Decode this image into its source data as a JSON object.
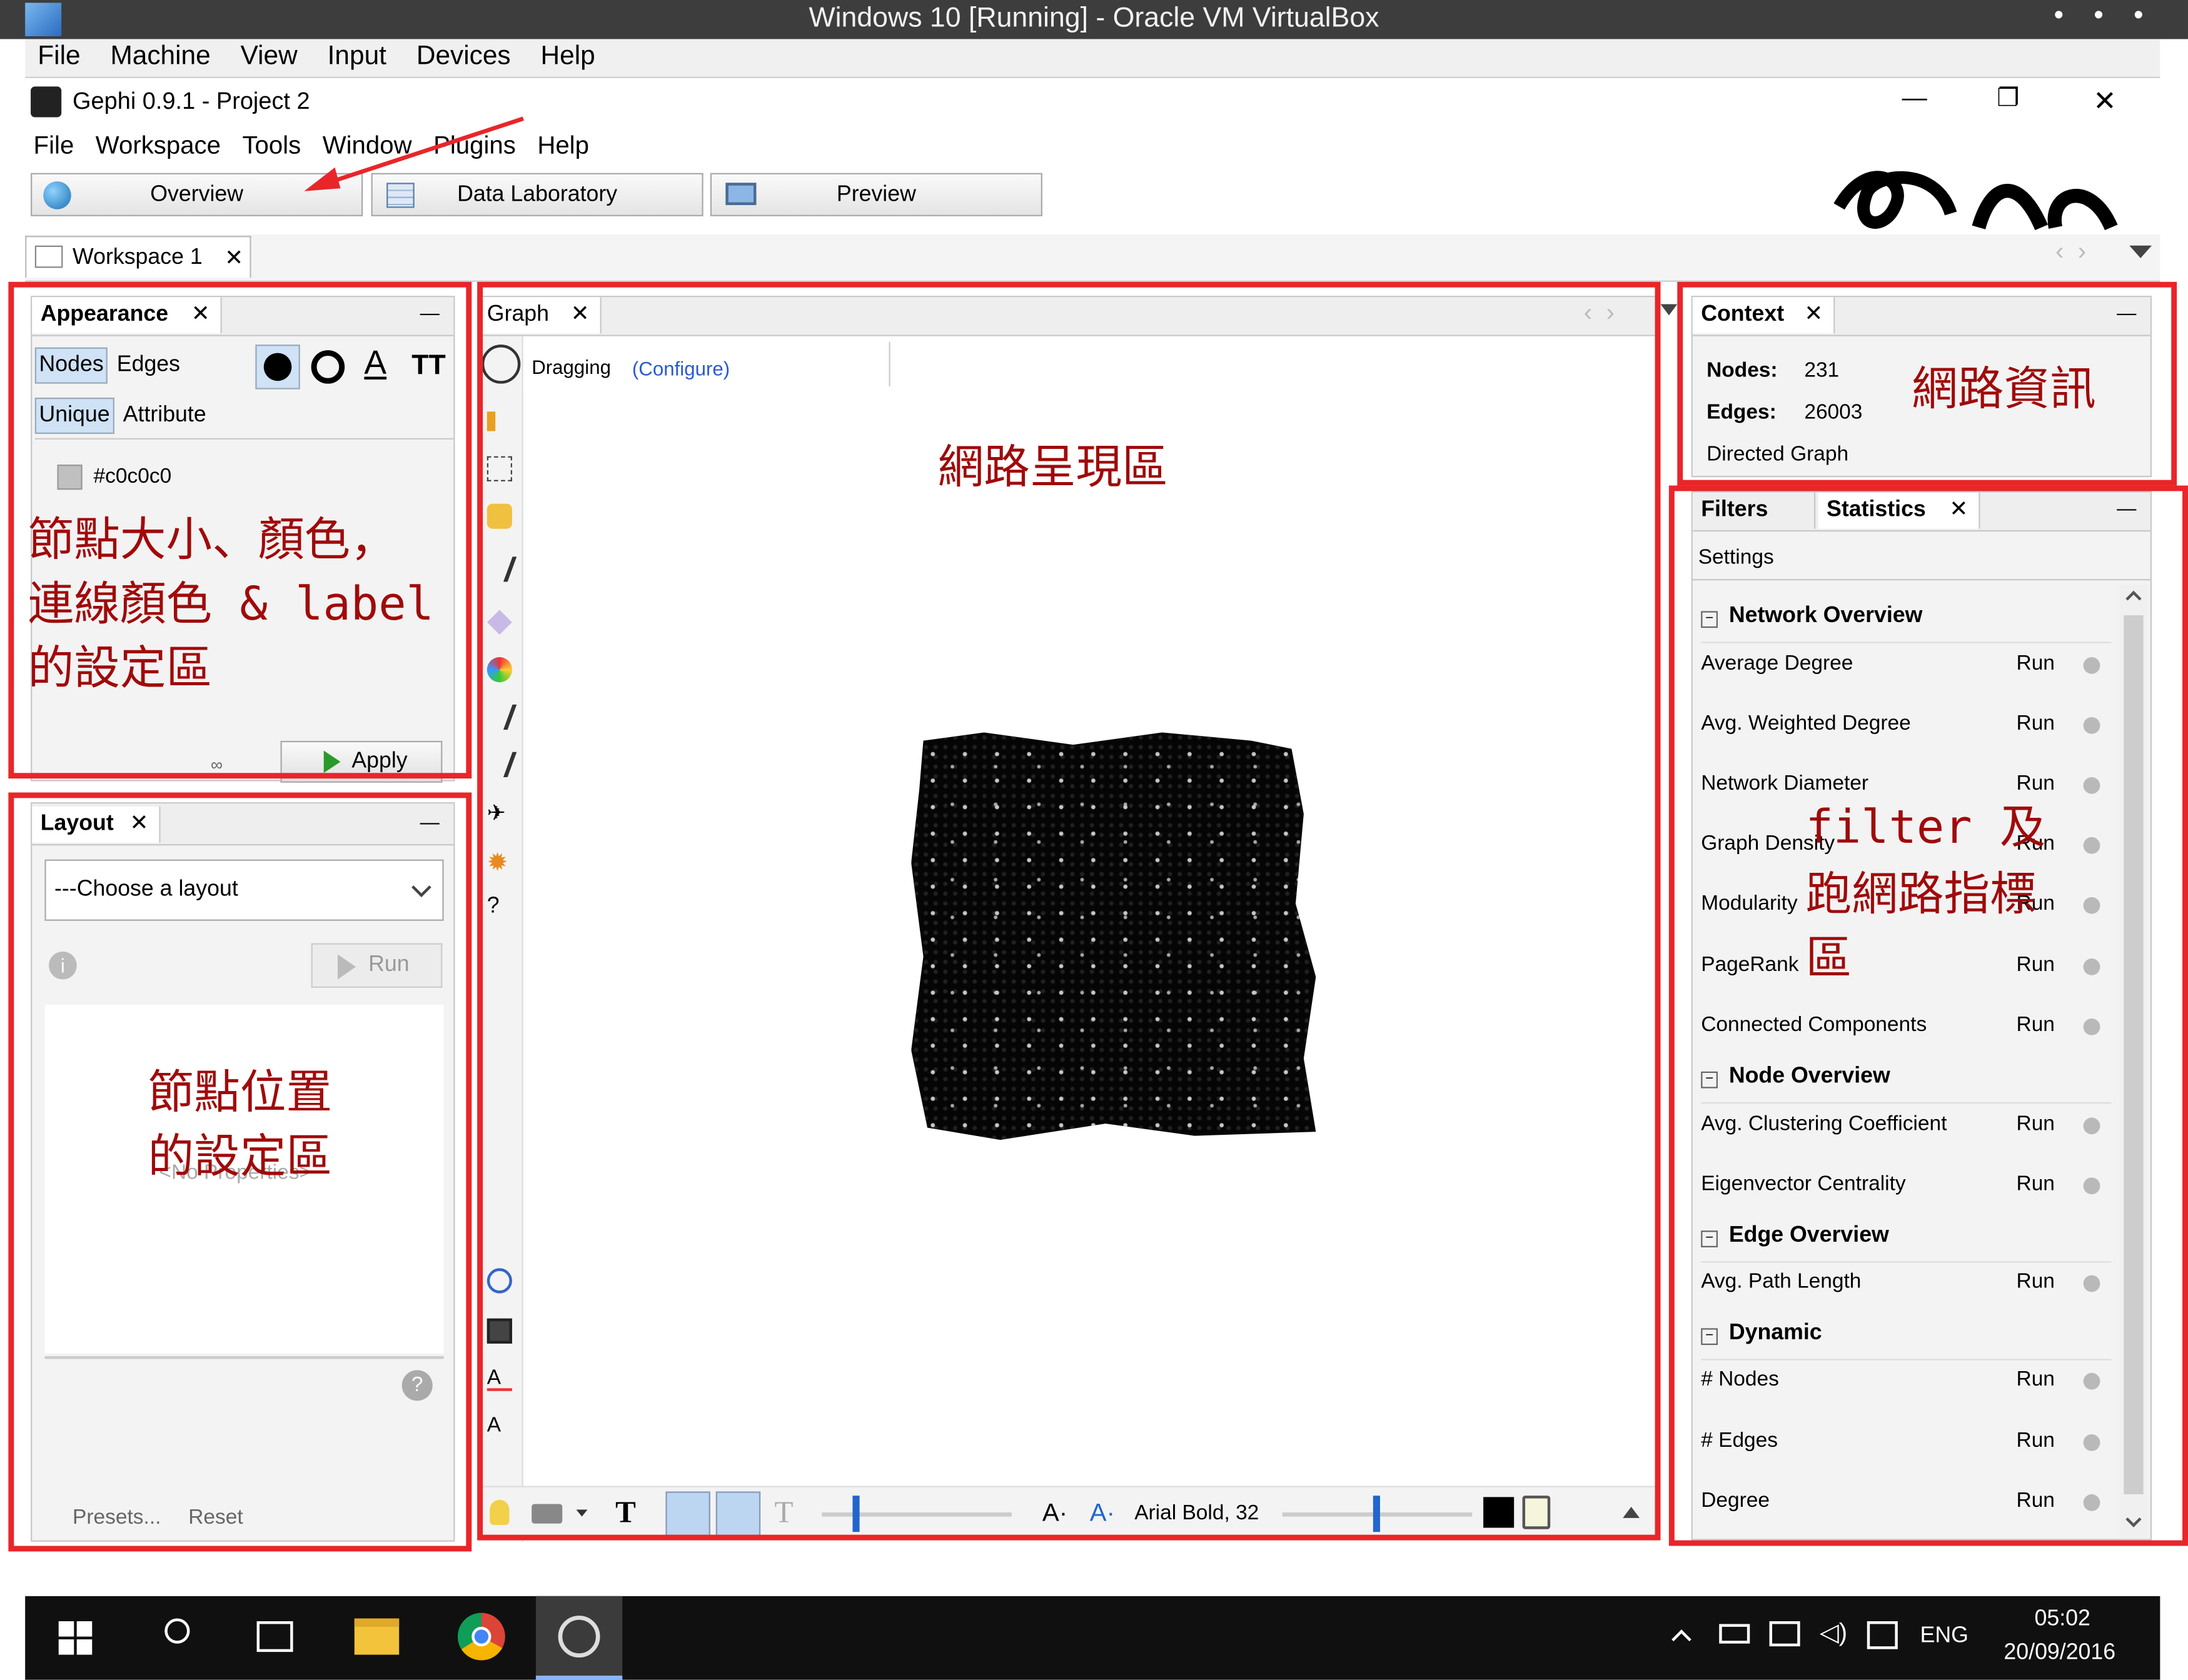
{
  "vbox": {
    "title": "Windows 10 [Running] - Oracle VM VirtualBox",
    "menu": [
      "File",
      "Machine",
      "View",
      "Input",
      "Devices",
      "Help"
    ],
    "dots": "• • •"
  },
  "gephi": {
    "app_title": "Gephi 0.9.1 - Project 2",
    "menu": [
      "File",
      "Workspace",
      "Tools",
      "Window",
      "Plugins",
      "Help"
    ],
    "tabs": {
      "overview": "Overview",
      "data_lab": "Data Laboratory",
      "preview": "Preview"
    },
    "workspace_tab": "Workspace 1",
    "win_min": "—",
    "win_max": "❐",
    "win_close": "✕"
  },
  "appearance": {
    "title": "Appearance",
    "close": "✕",
    "minimize": "—",
    "nodes": "Nodes",
    "edges": "Edges",
    "unique": "Unique",
    "attribute": "Attribute",
    "color": "#c0c0c0",
    "apply": "Apply"
  },
  "layout": {
    "title": "Layout",
    "close": "✕",
    "minimize": "—",
    "select": "---Choose a layout",
    "run": "Run",
    "no_props": "<No Properties>",
    "presets": "Presets...",
    "reset": "Reset"
  },
  "graph": {
    "title": "Graph",
    "close": "✕",
    "dragging": "Dragging",
    "configure": "(Configure)",
    "font": "Arial Bold, 32",
    "nodes_color": "#000000"
  },
  "context": {
    "title": "Context",
    "close": "✕",
    "minimize": "—",
    "nodes_label": "Nodes:",
    "nodes_value": "231",
    "edges_label": "Edges:",
    "edges_value": "26003",
    "graph_type": "Directed Graph"
  },
  "stats": {
    "filters_tab": "Filters",
    "statistics_tab": "Statistics",
    "close": "✕",
    "minimize": "—",
    "settings": "Settings",
    "run": "Run",
    "sections": [
      {
        "title": "Network Overview",
        "items": [
          "Average Degree",
          "Avg. Weighted Degree",
          "Network Diameter",
          "Graph Density",
          "Modularity",
          "PageRank",
          "Connected Components"
        ]
      },
      {
        "title": "Node Overview",
        "items": [
          "Avg. Clustering Coefficient",
          "Eigenvector Centrality"
        ]
      },
      {
        "title": "Edge Overview",
        "items": [
          "Avg. Path Length"
        ]
      },
      {
        "title": "Dynamic",
        "items": [
          "# Nodes",
          "# Edges",
          "Degree"
        ]
      }
    ]
  },
  "annotations": {
    "appearance": [
      "節點大小、顏色，",
      "連線顏色 & label",
      "的設定區"
    ],
    "layout": [
      "節點位置",
      "的設定區"
    ],
    "graph": "網路呈現區",
    "context": "網路資訊",
    "stats": [
      "filter 及",
      "跑網路指標",
      "區"
    ]
  },
  "taskbar": {
    "lang": "ENG",
    "time": "05:02",
    "date": "20/09/2016"
  },
  "colors": {
    "annotation_red": "#e8262a",
    "annotation_text": "#a00a0a",
    "taskbar": "#101010"
  }
}
